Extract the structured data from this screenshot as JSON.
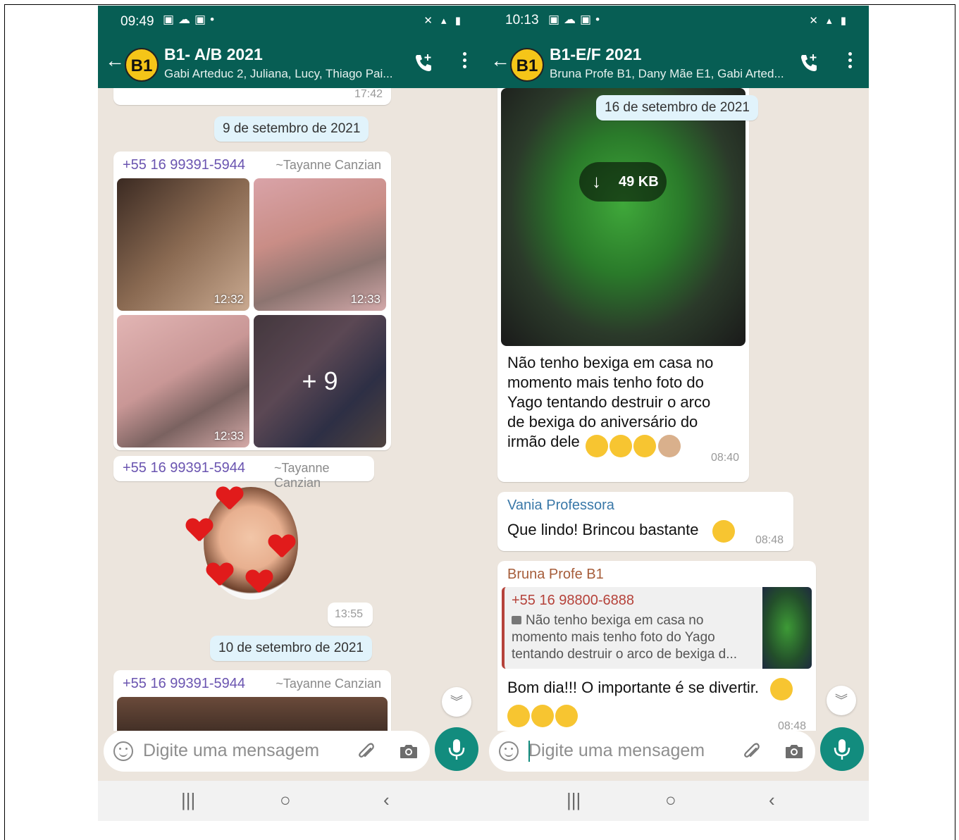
{
  "left": {
    "status": {
      "time": "09:49"
    },
    "header": {
      "avatar": "B1",
      "title": "B1- A/B 2021",
      "subtitle": "Gabi Arteduc 2, Juliana, Lucy, Thiago Pai..."
    },
    "chat": {
      "top_stub_time": "17:42",
      "date1": "9 de setembro de 2021",
      "msg1": {
        "sender": "+55 16 99391-5944",
        "pushname": "~Tayanne Canzian",
        "photos": [
          {
            "time": "12:32"
          },
          {
            "time": "12:33"
          },
          {
            "time": "12:33"
          },
          {
            "overlay": "+ 9"
          }
        ]
      },
      "msg2": {
        "sender": "+55 16 99391-5944",
        "pushname": "~Tayanne Canzian",
        "time": "13:55"
      },
      "date2": "10 de setembro de 2021",
      "msg3": {
        "sender": "+55 16 99391-5944",
        "pushname": "~Tayanne Canzian"
      }
    },
    "input": {
      "placeholder": "Digite uma mensagem"
    },
    "nav": {
      "recent": "|||",
      "home": "○",
      "back": "‹"
    }
  },
  "right": {
    "status": {
      "time": "10:13"
    },
    "header": {
      "avatar": "B1",
      "title": "B1-E/F 2021",
      "subtitle": "Bruna Profe B1, Dany Mãe E1, Gabi Arted..."
    },
    "chat": {
      "date1": "16 de setembro de 2021",
      "media": {
        "size": "49 KB"
      },
      "caption": "Não tenho bexiga em casa no momento mais tenho foto do Yago tentando destruir o arco de bexiga do aniversário do irmão dele",
      "caption_time": "08:40",
      "msg2": {
        "sender": "Vania Professora",
        "text": "Que lindo! Brincou  bastante",
        "time": "08:48"
      },
      "msg3": {
        "sender": "Bruna Profe B1",
        "quote_sender": "+55 16 98800-6888",
        "quote_text": "Não tenho bexiga em casa no momento mais tenho foto do Yago tentando destruir o arco de bexiga d...",
        "text": "Bom dia!!! O importante é se divertir.",
        "time": "08:48"
      }
    },
    "input": {
      "placeholder": "Digite uma mensagem"
    },
    "nav": {
      "recent": "|||",
      "home": "○",
      "back": "‹"
    }
  },
  "colors": {
    "header": "#075e54",
    "accent": "#128c7e",
    "chat_bg": "#ece5dd",
    "date_chip": "#e1f3fb"
  }
}
